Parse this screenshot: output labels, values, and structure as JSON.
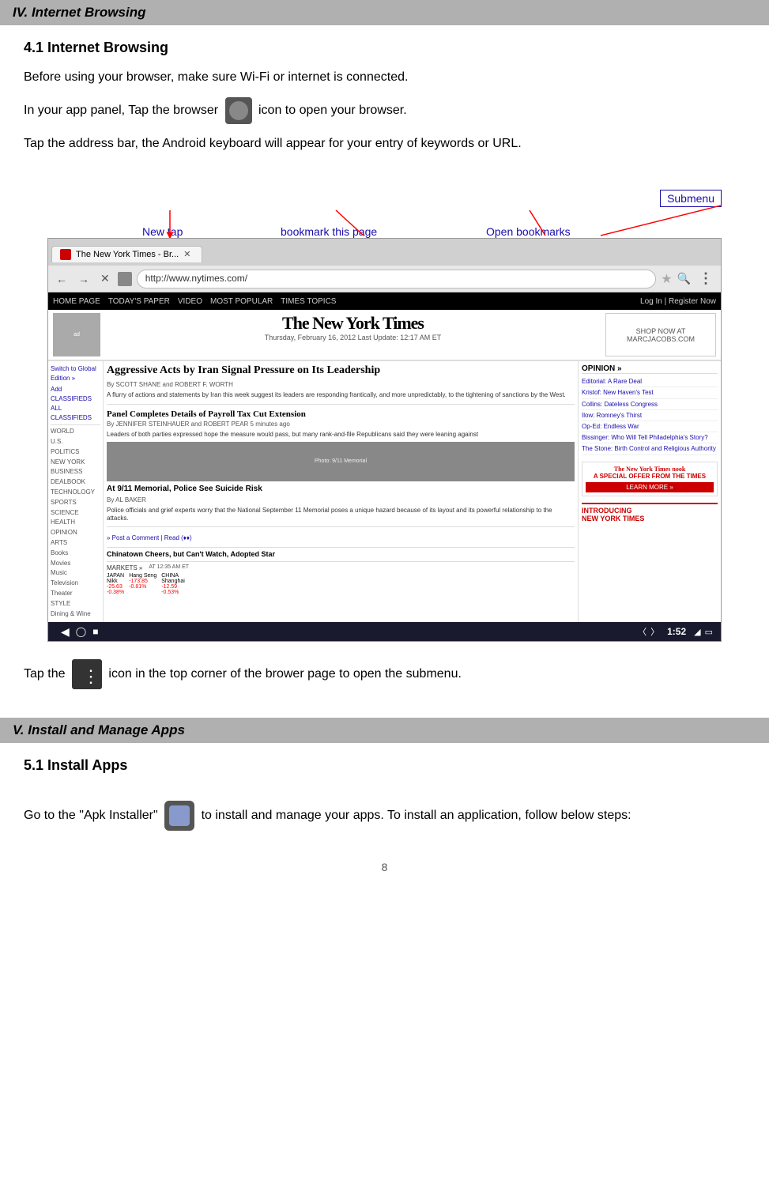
{
  "sections": {
    "section4_header": "IV. Internet Browsing",
    "section4_title": "4.1 Internet Browsing",
    "para1": "Before using your browser, make sure Wi-Fi or internet is connected.",
    "para2_pre": "In your app panel, Tap the browser",
    "para2_post": "icon to open your browser.",
    "para3": "Tap the address bar, the Android keyboard will appear for your entry of keywords or URL.",
    "annotations": {
      "new_tap": "New tap",
      "bookmark_this_page": "bookmark this page",
      "open_bookmarks": "Open bookmarks",
      "submenu": "Submenu"
    },
    "browser": {
      "tab_title": "The New York Times - Br...",
      "url": "http://www.nytimes.com/",
      "nav_items": [
        "HOME PAGE",
        "TODAY'S PAPER",
        "VIDEO",
        "MOST POPULAR",
        "TIMES TOPICS"
      ],
      "login_text": "Log In | Register Now",
      "logo": "The New York Times",
      "date_line": "Thursday, February 16, 2012   Last Update: 12:17 AM ET",
      "ad_text": "SHOP NOW AT MARCJACOBS.COM",
      "headline1": "Aggressive Acts by Iran Signal Pressure on Its Leadership",
      "byline1": "By SCOTT SHANE and ROBERT F. WORTH",
      "body1": "A flurry of actions and statements by Iran this week suggest its leaders are responding frantically, and more unpredictably, to the tightening of sanctions by the West.",
      "headline2": "Panel Completes Details of Payroll Tax Cut Extension",
      "byline2": "By JENNIFER STEINHAUER and ROBERT PEAR 5 minutes ago",
      "body2": "Leaders of both parties expressed hope the measure would pass, but many rank-and-file Republicans said they were leaning against",
      "headline3": "At 9/11 Memorial, Police See Suicide Risk",
      "byline3": "By AL BAKER",
      "body3": "Police officials and grief experts worry that the National September 11 Memorial poses a unique hazard because of its layout and its powerful relationship to the attacks.",
      "headline4": "Chinatown Cheers, but Can't Watch, Adopted Star",
      "opinion_head": "OPINION »",
      "opinion1": "Editorial: A Rare Deal",
      "opinion2": "Kristof: New Haven's Test",
      "opinion3": "Collins: Dateless Congress",
      "opinion4": "Ilow: Romney's Thirst",
      "opinion5": "Op-Ed: Endless War",
      "opinion6": "Bissinger: Who Will Tell Philadelphia's Story?",
      "opinion7": "The Stone: Birth Control and Religious Authority",
      "markets_head": "MARKETS »",
      "market_time": "AT 12:35 AM ET",
      "status_time": "1:52",
      "left_nav_items": [
        "Add",
        "CLASSIFIEDS",
        "",
        "WORLD",
        "U.S.",
        "POLITICS",
        "NEW YORK",
        "BUSINESS",
        "DEALBOOK",
        "TECHNOLOGY",
        "SPORTS",
        "SCIENCE",
        "HEALTH",
        "OPINION",
        "ARTS",
        "Books",
        "Movies",
        "Music",
        "Television",
        "Theater",
        "STYLE",
        "Dining & Wine"
      ]
    },
    "bottom_para_pre": "Tap the",
    "bottom_para_post": "icon in the top corner of the brower page to open the submenu.",
    "section5_header": "V. Install and Manage Apps",
    "section5_title": "5.1 Install Apps",
    "section5_para_pre": "Go  to  the  \"Apk  Installer\"",
    "section5_para_post": "to  install  and  manage  your  apps.  To install an application, follow below steps:",
    "page_number": "8"
  }
}
